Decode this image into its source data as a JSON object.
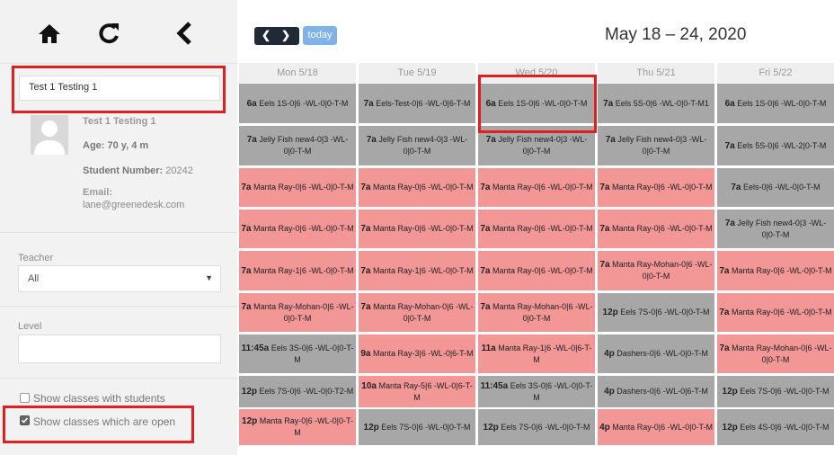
{
  "sidebar": {
    "student_search_value": "Test 1 Testing 1",
    "student_name": "Test 1 Testing 1",
    "age_label": "Age:",
    "age_value": "70 y, 4 m",
    "student_number_label": "Student Number:",
    "student_number_value": "20242",
    "email_label": "Email:",
    "email_value": "lane@greenedesk.com",
    "teacher_label": "Teacher",
    "teacher_value": "All",
    "level_label": "Level",
    "level_value": "",
    "checkbox_students_label": "Show classes with students",
    "checkbox_students_checked": false,
    "checkbox_open_label": "Show classes which are open",
    "checkbox_open_checked": true
  },
  "header": {
    "today_label": "today",
    "date_range": "May 18 – 24, 2020"
  },
  "days": [
    "Mon 5/18",
    "Tue 5/19",
    "Wed 5/20",
    "Thu 5/21",
    "Fri 5/22"
  ],
  "rows": [
    [
      {
        "t": "6a",
        "n": "Eels 1S-0|6 -WL-0|0-T-M",
        "c": "gray"
      },
      {
        "t": "7a",
        "n": "Eels-Test-0|6 -WL-0|6-T-M",
        "c": "gray"
      },
      {
        "t": "6a",
        "n": "Eels 1S-0|6 -WL-0|0-T-M",
        "c": "gray"
      },
      {
        "t": "7a",
        "n": "Eels 5S-0|6 -WL-0|0-T-M1",
        "c": "gray"
      },
      {
        "t": "6a",
        "n": "Eels 1S-0|6 -WL-0|0-T-M",
        "c": "gray"
      }
    ],
    [
      {
        "t": "7a",
        "n": "Jelly Fish new4-0|3 -WL-0|0-T-M",
        "c": "gray"
      },
      {
        "t": "7a",
        "n": "Jelly Fish new4-0|3 -WL-0|0-T-M",
        "c": "gray"
      },
      {
        "t": "7a",
        "n": "Jelly Fish new4-0|3 -WL-0|0-T-M",
        "c": "gray"
      },
      {
        "t": "7a",
        "n": "Jelly Fish new4-0|3 -WL-0|0-T-M",
        "c": "gray"
      },
      {
        "t": "7a",
        "n": "Eels 5S-0|6 -WL-2|0-T-M",
        "c": "gray"
      }
    ],
    [
      {
        "t": "7a",
        "n": "Manta Ray-0|6 -WL-0|0-T-M",
        "c": "pink"
      },
      {
        "t": "7a",
        "n": "Manta Ray-0|6 -WL-0|0-T-M",
        "c": "pink"
      },
      {
        "t": "7a",
        "n": "Manta Ray-0|6 -WL-0|0-T-M",
        "c": "pink"
      },
      {
        "t": "7a",
        "n": "Manta Ray-0|6 -WL-0|0-T-M",
        "c": "pink"
      },
      {
        "t": "7a",
        "n": "Eels-0|6 -WL-0|0-T-M",
        "c": "gray"
      }
    ],
    [
      {
        "t": "7a",
        "n": "Manta Ray-0|6 -WL-0|0-T-M",
        "c": "pink"
      },
      {
        "t": "7a",
        "n": "Manta Ray-0|6 -WL-0|0-T-M",
        "c": "pink"
      },
      {
        "t": "7a",
        "n": "Manta Ray-0|6 -WL-0|0-T-M",
        "c": "pink"
      },
      {
        "t": "7a",
        "n": "Manta Ray-0|6 -WL-0|0-T-M",
        "c": "pink"
      },
      {
        "t": "7a",
        "n": "Jelly Fish new4-0|3 -WL-0|0-T-M",
        "c": "gray"
      }
    ],
    [
      {
        "t": "7a",
        "n": "Manta Ray-1|6 -WL-0|0-T-M",
        "c": "pink"
      },
      {
        "t": "7a",
        "n": "Manta Ray-1|6 -WL-0|0-T-M",
        "c": "pink"
      },
      {
        "t": "7a",
        "n": "Manta Ray-0|6 -WL-0|0-T-M",
        "c": "pink"
      },
      {
        "t": "7a",
        "n": "Manta Ray-Mohan-0|6 -WL-0|0-T-M",
        "c": "pink"
      },
      {
        "t": "7a",
        "n": "Manta Ray-0|6 -WL-0|0-T-M",
        "c": "pink"
      }
    ],
    [
      {
        "t": "7a",
        "n": "Manta Ray-Mohan-0|6 -WL-0|0-T-M",
        "c": "pink"
      },
      {
        "t": "7a",
        "n": "Manta Ray-Mohan-0|6 -WL-0|0-T-M",
        "c": "pink"
      },
      {
        "t": "7a",
        "n": "Manta Ray-Mohan-0|6 -WL-0|0-T-M",
        "c": "pink"
      },
      {
        "t": "12p",
        "n": "Eels 7S-0|6 -WL-0|0-T-M",
        "c": "gray"
      },
      {
        "t": "7a",
        "n": "Manta Ray-0|6 -WL-0|0-T-M",
        "c": "pink"
      }
    ],
    [
      {
        "t": "11:45a",
        "n": "Eels 3S-0|6 -WL-0|0-T-M",
        "c": "gray"
      },
      {
        "t": "9a",
        "n": "Manta Ray-3|6 -WL-0|6-T-M",
        "c": "pink"
      },
      {
        "t": "11a",
        "n": "Manta Ray-1|6 -WL-0|6-T-M",
        "c": "pink"
      },
      {
        "t": "4p",
        "n": "Dashers-0|6 -WL-0|0-T-M",
        "c": "gray"
      },
      {
        "t": "7a",
        "n": "Manta Ray-Mohan-0|6 -WL-0|0-T-M",
        "c": "pink"
      }
    ],
    [
      {
        "t": "12p",
        "n": "Eels 7S-0|6 -WL-0|0-T2-M",
        "c": "gray"
      },
      {
        "t": "10a",
        "n": "Manta Ray-5|6 -WL-0|6-T-M",
        "c": "pink"
      },
      {
        "t": "11:45a",
        "n": "Eels 3S-0|6 -WL-0|0-T-M",
        "c": "gray"
      },
      {
        "t": "4p",
        "n": "Dashers-0|6 -WL-0|6-T-M",
        "c": "gray"
      },
      {
        "t": "12p",
        "n": "Eels 7S-0|6 -WL-0|0-T-M",
        "c": "gray"
      }
    ],
    [
      {
        "t": "12p",
        "n": "Manta Ray-0|6 -WL-0|0-T-M",
        "c": "pink"
      },
      {
        "t": "12p",
        "n": "Eels 7S-0|6 -WL-0|0-T-M",
        "c": "gray"
      },
      {
        "t": "12p",
        "n": "Eels 7S-0|6 -WL-0|0-T-M",
        "c": "gray"
      },
      {
        "t": "4p",
        "n": "Manta Ray-0|6 -WL-0|0-T-M",
        "c": "pink"
      },
      {
        "t": "12p",
        "n": "Eels 4S-0|6 -WL-0|0-T-M",
        "c": "gray"
      }
    ]
  ],
  "colors": {
    "gray": "#a7a7a7",
    "pink": "#f29696",
    "highlight": "#e02020",
    "today": "#7fb2e8"
  }
}
